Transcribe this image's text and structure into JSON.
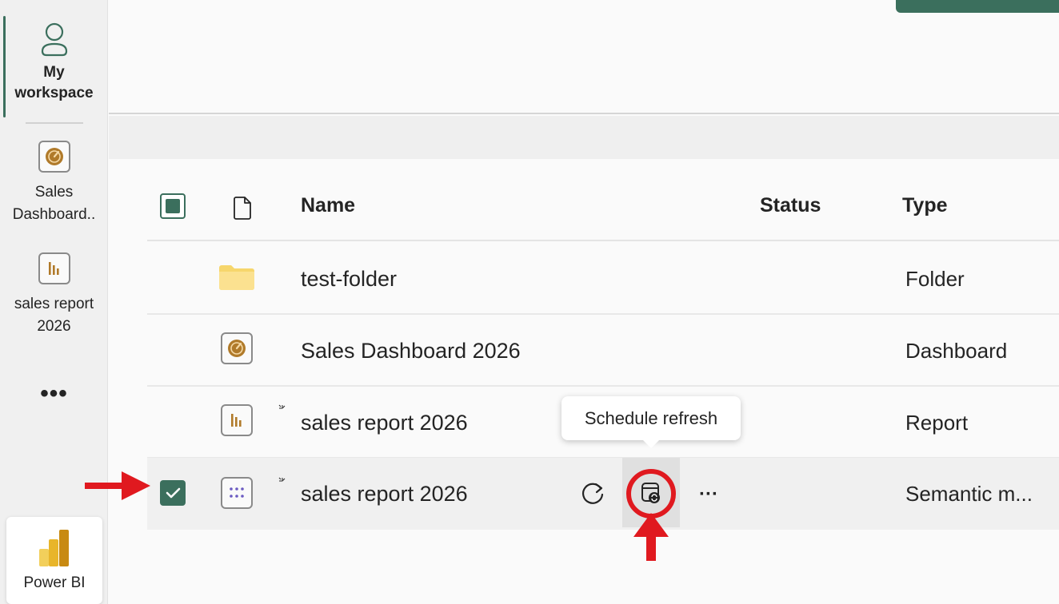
{
  "rail": {
    "items": [
      {
        "label_line1": "My",
        "label_line2": "workspace",
        "icon": "person-icon"
      },
      {
        "label_line1": "Sales",
        "label_line2": "Dashboard..",
        "icon": "dashboard-gauge-icon"
      },
      {
        "label_line1": "sales report",
        "label_line2": "2026",
        "icon": "report-bar-icon"
      }
    ],
    "more_label": "•••",
    "app_label": "Power BI"
  },
  "table": {
    "headers": {
      "name": "Name",
      "status": "Status",
      "type": "Type"
    },
    "rows": [
      {
        "name": "test-folder",
        "type": "Folder",
        "icon": "folder-icon"
      },
      {
        "name": "Sales Dashboard 2026",
        "type": "Dashboard",
        "icon": "dashboard-gauge-icon"
      },
      {
        "name": "sales report 2026",
        "type": "Report",
        "icon": "report-bar-icon"
      },
      {
        "name": "sales report 2026",
        "type": "Semantic m...",
        "icon": "semantic-model-icon",
        "selected": true
      }
    ]
  },
  "tooltip": {
    "text": "Schedule refresh"
  },
  "colors": {
    "accent": "#3b6f5d",
    "gold": "#b07a2a",
    "annotation_red": "#e0191f"
  }
}
